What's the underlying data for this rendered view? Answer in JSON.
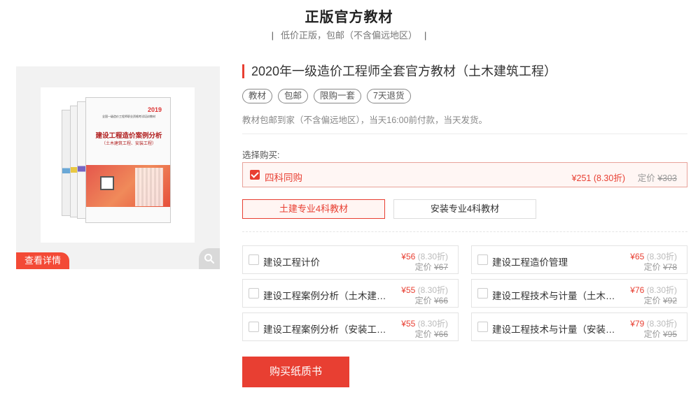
{
  "header": {
    "title": "正版官方教材",
    "subtitle": "低价正版，包邮（不含偏远地区）",
    "bar_left": "|",
    "bar_right": "|"
  },
  "image_panel": {
    "detail_label": "查看详情",
    "book_year": "2019",
    "book_series": "全国一级造价工程师职业资格考试培训教材",
    "book_title": "建设工程造价案例分析",
    "book_subtitle": "（土木建筑工程、安装工程）",
    "zoom_icon": "search-icon"
  },
  "product": {
    "title": "2020年一级造价工程师全套官方教材（土木建筑工程）",
    "tags": [
      "教材",
      "包邮",
      "限购一套",
      "7天退货"
    ],
    "shipping_note": "教材包邮到家（不含偏远地区），当天16:00前付款，当天发货。",
    "choose_label": "选择购买:",
    "bundle": {
      "name": "四科同购",
      "price": "¥251 (8.30折)",
      "list_label": "定价",
      "list_price": "¥303",
      "selected": true
    },
    "options": [
      {
        "label": "土建专业4科教材",
        "active": true
      },
      {
        "label": "安装专业4科教材",
        "active": false
      }
    ],
    "items": [
      {
        "name": "建设工程计价",
        "price": "¥56",
        "discount": "(8.30折)",
        "list_label": "定价",
        "list_price": "¥67"
      },
      {
        "name": "建设工程造价管理",
        "price": "¥65",
        "discount": "(8.30折)",
        "list_label": "定价",
        "list_price": "¥78"
      },
      {
        "name": "建设工程案例分析（土木建筑...",
        "price": "¥55",
        "discount": "(8.30折)",
        "list_label": "定价",
        "list_price": "¥66"
      },
      {
        "name": "建设工程技术与计量（土木建...",
        "price": "¥76",
        "discount": "(8.30折)",
        "list_label": "定价",
        "list_price": "¥92"
      },
      {
        "name": "建设工程案例分析（安装工程）",
        "price": "¥55",
        "discount": "(8.30折)",
        "list_label": "定价",
        "list_price": "¥66"
      },
      {
        "name": "建设工程技术与计量（安装工...",
        "price": "¥79",
        "discount": "(8.30折)",
        "list_label": "定价",
        "list_price": "¥95"
      }
    ],
    "buy_label": "购买纸质书"
  },
  "colors": {
    "accent": "#e83f32",
    "tag_orange": "#f34a36"
  }
}
